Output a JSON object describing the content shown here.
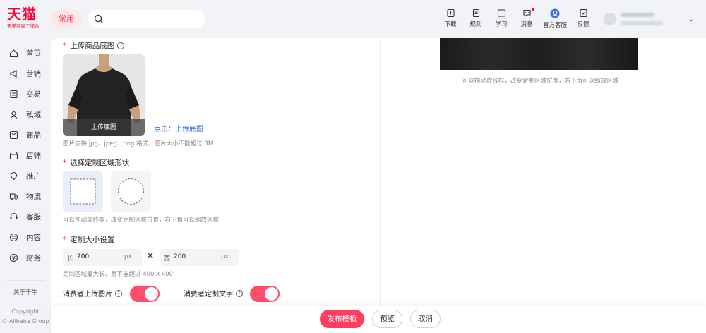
{
  "brand": {
    "name": "天猫",
    "subtitle": "天猫商家工作台"
  },
  "header": {
    "common_label": "常用",
    "search_placeholder": "",
    "tools": [
      {
        "label": "下载",
        "icon": "download-icon"
      },
      {
        "label": "规则",
        "icon": "rules-icon"
      },
      {
        "label": "学习",
        "icon": "learn-icon"
      },
      {
        "label": "消息",
        "icon": "message-icon"
      },
      {
        "label": "官方客服",
        "icon": "customer-service-icon"
      },
      {
        "label": "反馈",
        "icon": "feedback-icon"
      }
    ]
  },
  "sidebar": {
    "items": [
      {
        "label": "首页",
        "icon": "home-icon"
      },
      {
        "label": "营销",
        "icon": "marketing-icon"
      },
      {
        "label": "交易",
        "icon": "trade-icon"
      },
      {
        "label": "私域",
        "icon": "private-domain-icon"
      },
      {
        "label": "商品",
        "icon": "goods-icon"
      },
      {
        "label": "店铺",
        "icon": "store-icon"
      },
      {
        "label": "推广",
        "icon": "promotion-icon"
      },
      {
        "label": "物流",
        "icon": "logistics-icon"
      },
      {
        "label": "客服",
        "icon": "service-icon"
      },
      {
        "label": "内容",
        "icon": "content-icon"
      },
      {
        "label": "财务",
        "icon": "finance-icon"
      }
    ],
    "about": "关于千牛",
    "copyright_line1": "Copyright",
    "copyright_line2": "© Alibaba Group"
  },
  "form": {
    "upload": {
      "title": "上传商品底图",
      "button_label": "上传底图",
      "link_prefix": "点击：",
      "link_label": "上传底图",
      "hint": "图片支持 jpg、jpeg、png 格式，图片大小不能超过 3M"
    },
    "shape": {
      "title": "选择定制区域形状",
      "hint": "可以拖动虚线框，改变定制区域位置，右下角可以缩放区域"
    },
    "size": {
      "title": "定制大小设置",
      "length_key": "长",
      "length_value": "200",
      "width_key": "宽",
      "width_value": "200",
      "unit": "px",
      "times": "✕",
      "hint": "定制区域最大长、宽不能超过 400 x 400"
    },
    "toggles": {
      "consumer_image_label": "消费者上传图片",
      "consumer_text_label": "消费者定制文字"
    }
  },
  "preview": {
    "hint": "可以拖动虚线框，改变定制区域位置，右下角可以缩放区域"
  },
  "footer": {
    "publish": "发布模板",
    "preview": "预览",
    "cancel": "取消"
  },
  "colors": {
    "accent": "#ff3d5c",
    "brand": "#ff0036",
    "link": "#2f6fd6"
  }
}
